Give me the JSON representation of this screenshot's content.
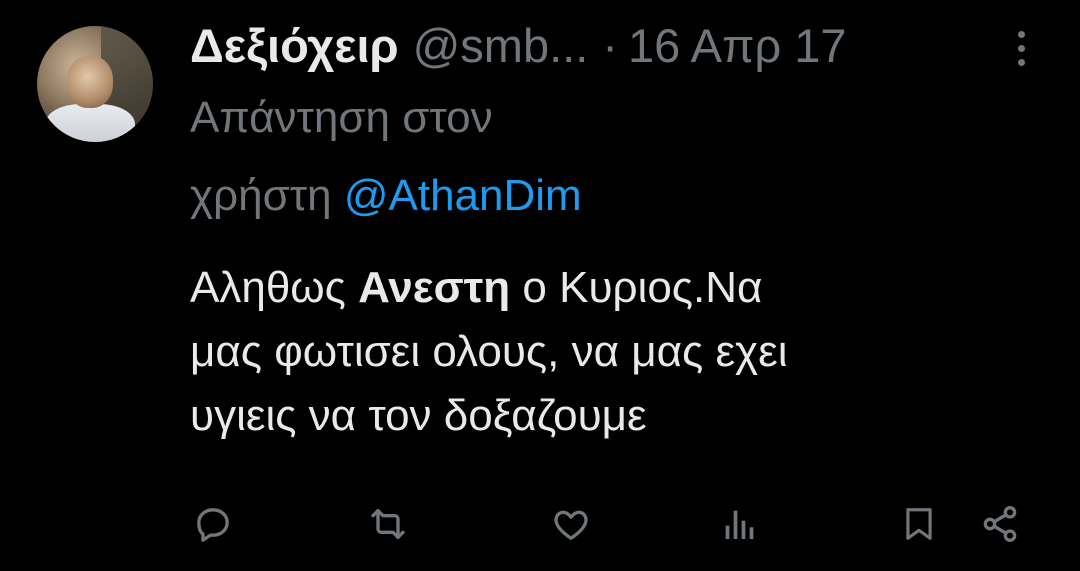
{
  "tweet": {
    "display_name": "Δεξιόχειρ",
    "handle": "@smb...",
    "separator": "·",
    "date": "16 Απρ 17",
    "reply_line1": "Απάντηση στον",
    "reply_line2_prefix": "χρήστη",
    "reply_mention": "@AthanDim",
    "text_part1": "Αληθως ",
    "text_bold": "Ανεστη",
    "text_part2": " ο Κυριος.Να",
    "text_line2": "μας φωτισει ολους, να μας εχει",
    "text_line3": "υγιεις να τον δοξαζουμε"
  },
  "icons": {
    "avatar": "user-avatar-photo",
    "more": "more-vertical-icon",
    "reply": "reply-icon",
    "retweet": "retweet-icon",
    "like": "heart-icon",
    "views": "views-icon",
    "bookmark": "bookmark-icon",
    "share": "share-icon"
  },
  "colors": {
    "background": "#000000",
    "primary_text": "#e7e9ea",
    "secondary_text": "#71767b",
    "link": "#1d9bf0"
  }
}
